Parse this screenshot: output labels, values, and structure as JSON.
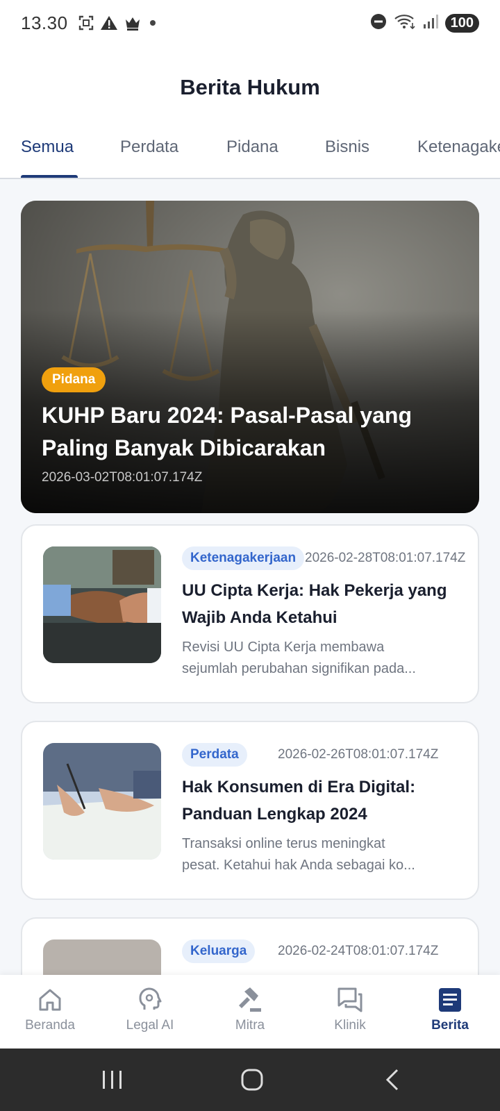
{
  "status": {
    "time": "13.30",
    "battery": "100"
  },
  "header": {
    "title": "Berita Hukum"
  },
  "tabs": [
    {
      "label": "Semua",
      "active": true
    },
    {
      "label": "Perdata",
      "active": false
    },
    {
      "label": "Pidana",
      "active": false
    },
    {
      "label": "Bisnis",
      "active": false
    },
    {
      "label": "Ketenagakerjaan",
      "active": false
    }
  ],
  "featured": {
    "category": "Pidana",
    "title": "KUHP Baru 2024: Pasal-Pasal yang Paling Banyak Dibicarakan",
    "date": "2026-03-02T08:01:07.174Z"
  },
  "articles": [
    {
      "category": "Ketenagakerjaan",
      "date": "2026-02-28T08:01:07.174Z",
      "title": "UU Cipta Kerja: Hak Pekerja yang Wajib Anda Ketahui",
      "desc_line1": "Revisi UU Cipta Kerja membawa",
      "desc_line2": "sejumlah perubahan signifikan pada..."
    },
    {
      "category": "Perdata",
      "date": "2026-02-26T08:01:07.174Z",
      "title": "Hak Konsumen di Era Digital: Panduan Lengkap 2024",
      "desc_line1": "Transaksi online terus meningkat",
      "desc_line2": "pesat. Ketahui hak Anda sebagai ko..."
    },
    {
      "category": "Keluarga",
      "date": "2026-02-24T08:01:07.174Z"
    }
  ],
  "bottom_nav": [
    {
      "label": "Beranda",
      "icon": "home-icon",
      "active": false
    },
    {
      "label": "Legal AI",
      "icon": "ai-brain-icon",
      "active": false
    },
    {
      "label": "Mitra",
      "icon": "gavel-icon",
      "active": false
    },
    {
      "label": "Klinik",
      "icon": "chat-icon",
      "active": false
    },
    {
      "label": "Berita",
      "icon": "news-icon",
      "active": true
    }
  ],
  "colors": {
    "primary": "#1e3a78",
    "badge_featured": "#f0a00e",
    "badge_article_bg": "#e7effb",
    "badge_article_text": "#3366cc"
  }
}
